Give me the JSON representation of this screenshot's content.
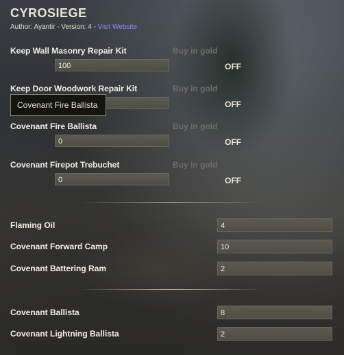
{
  "addon": {
    "title": "CYROSIEGE",
    "author_text": "Author: Ayantir - Version: 4 - ",
    "website_link": "Visit Website"
  },
  "siege_items": [
    {
      "label": "Keep Wall Masonry Repair Kit",
      "buy_label": "Buy in gold",
      "value": "100",
      "toggle": "OFF"
    },
    {
      "label": "Keep Door Woodwork Repair Kit",
      "buy_label": "Buy in gold",
      "value": "",
      "toggle": "OFF"
    },
    {
      "label": "Covenant Fire Ballista",
      "buy_label": "Buy in gold",
      "value": "0",
      "toggle": "OFF"
    },
    {
      "label": "Covenant Firepot Trebuchet",
      "buy_label": "Buy in gold",
      "value": "0",
      "toggle": "OFF"
    }
  ],
  "tooltip": {
    "text": "Covenant Fire Ballista"
  },
  "group_two": [
    {
      "label": "Flaming Oil",
      "value": "4"
    },
    {
      "label": "Covenant Forward Camp",
      "value": "10"
    },
    {
      "label": "Covenant Battering Ram",
      "value": "2"
    }
  ],
  "group_three": [
    {
      "label": "Covenant Ballista",
      "value": "8"
    },
    {
      "label": "Covenant Lightning Ballista",
      "value": "2"
    }
  ]
}
